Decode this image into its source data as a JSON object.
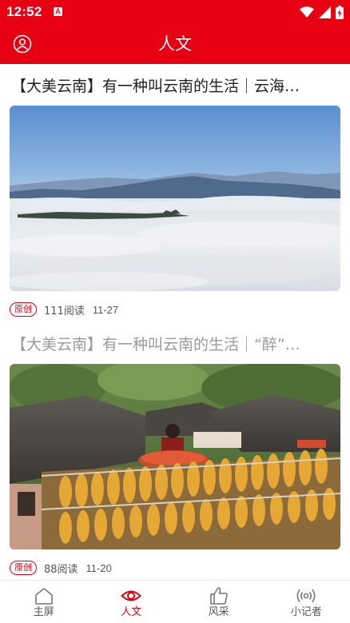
{
  "status_bar": {
    "time": "12:52",
    "notification_badge": "A",
    "icons": [
      "wifi-icon",
      "signal-icon",
      "battery-charging-icon"
    ]
  },
  "header": {
    "title": "人文",
    "left_icon": "profile-icon"
  },
  "articles": [
    {
      "title": "【大美云南】有一种叫云南的生活｜云海…",
      "image": "sea-of-clouds-mountains",
      "badge": "原创",
      "reads": "111阅读",
      "date": "11-27",
      "read": false
    },
    {
      "title": "【大美云南】有一种叫云南的生活｜“醉”…",
      "image": "village-harvest-corn-drying",
      "badge": "原创",
      "reads": "88阅读",
      "date": "11-20",
      "read": true
    }
  ],
  "bottom_nav": {
    "items": [
      {
        "label": "主屏",
        "icon": "home-icon",
        "active": false
      },
      {
        "label": "人文",
        "icon": "eye-icon",
        "active": true
      },
      {
        "label": "风采",
        "icon": "thumbs-up-icon",
        "active": false
      },
      {
        "label": "小记者",
        "icon": "broadcast-icon",
        "active": false
      }
    ]
  },
  "colors": {
    "brand_red": "#e60012",
    "text_primary": "#222222",
    "text_read": "#9a9a9a",
    "text_meta": "#555555"
  }
}
